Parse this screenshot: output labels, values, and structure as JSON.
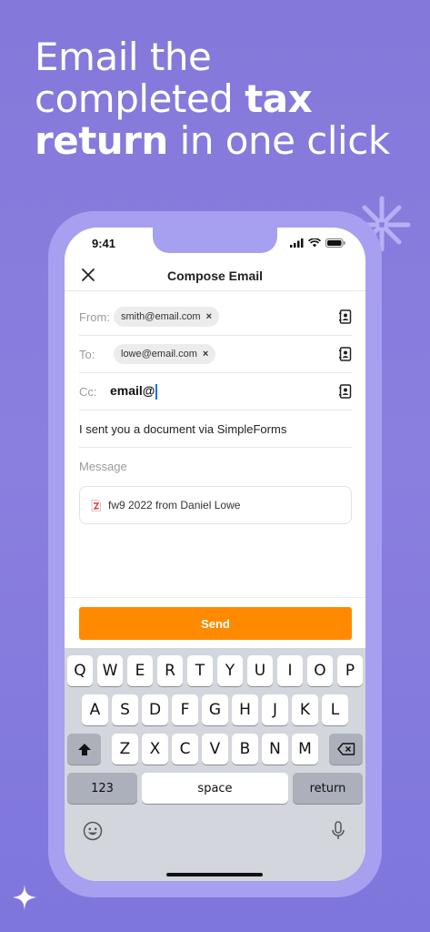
{
  "headline": {
    "line1": "Email the",
    "line2_pre": "completed ",
    "line2_bold": "tax",
    "line3_bold": "return",
    "line3_post": " in one click"
  },
  "status": {
    "time": "9:41"
  },
  "compose": {
    "title": "Compose Email",
    "from_label": "From:",
    "from_value": "smith@email.com",
    "to_label": "To:",
    "to_value": "lowe@email.com",
    "cc_label": "Cc:",
    "cc_value": "email@",
    "subject": "I sent you a document via SimpleForms",
    "message_placeholder": "Message",
    "attachment_name": "fw9  2022 from Daniel Lowe",
    "chip_remove": "×",
    "send_label": "Send"
  },
  "keyboard": {
    "row1": [
      "Q",
      "W",
      "E",
      "R",
      "T",
      "Y",
      "U",
      "I",
      "O",
      "P"
    ],
    "row2": [
      "A",
      "S",
      "D",
      "F",
      "G",
      "H",
      "J",
      "K",
      "L"
    ],
    "row3": [
      "Z",
      "X",
      "C",
      "V",
      "B",
      "N",
      "M"
    ],
    "numbers_label": "123",
    "space_label": "space",
    "return_label": "return"
  },
  "colors": {
    "accent": "#ff8a00",
    "background": "#8478da",
    "frame": "#a79ff0"
  }
}
